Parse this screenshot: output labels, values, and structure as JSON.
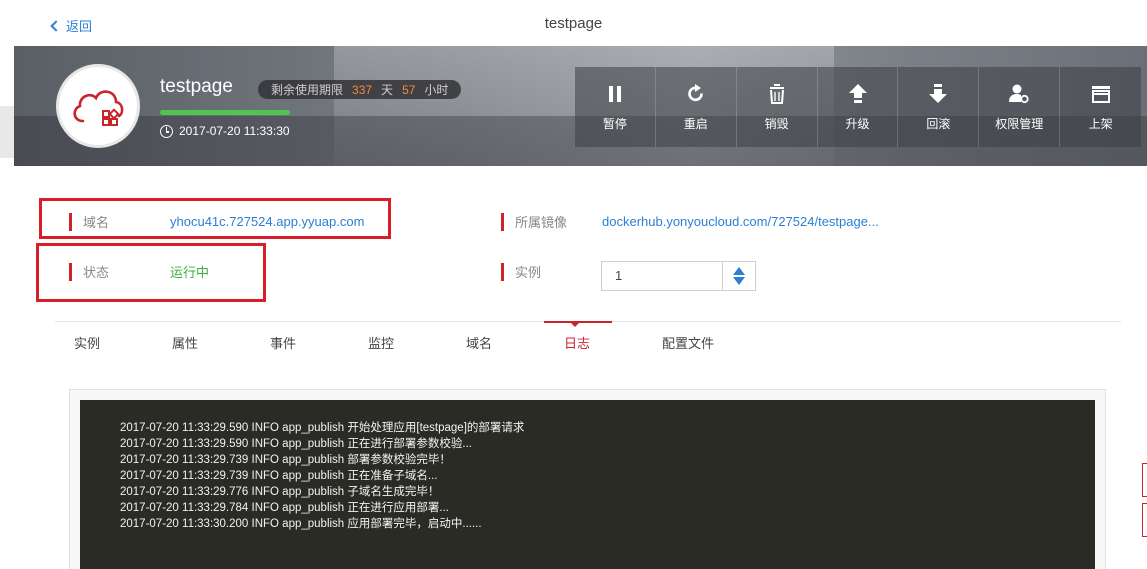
{
  "topbar": {
    "back_label": "返回",
    "title": "testpage"
  },
  "app": {
    "name": "testpage",
    "remaining": {
      "prefix": "剩余使用期限",
      "days": "337",
      "day_unit": "天",
      "hours": "57",
      "hour_unit": "小时"
    },
    "created_at": "2017-07-20 11:33:30",
    "progress_fraction": 1.0,
    "progress_color": "#50c650"
  },
  "actions": [
    {
      "label": "暂停",
      "icon": "pause-icon"
    },
    {
      "label": "重启",
      "icon": "restart-icon"
    },
    {
      "label": "销毁",
      "icon": "trash-icon"
    },
    {
      "label": "升级",
      "icon": "upgrade-icon"
    },
    {
      "label": "回滚",
      "icon": "rollback-icon"
    },
    {
      "label": "权限管理",
      "icon": "user-permission-icon"
    },
    {
      "label": "上架",
      "icon": "shelf-icon"
    }
  ],
  "info": {
    "domain_label": "域名",
    "domain_value": "yhocu41c.727524.app.yyuap.com",
    "status_label": "状态",
    "status_value": "运行中",
    "image_label": "所属镜像",
    "image_value": "dockerhub.yonyoucloud.com/727524/testpage...",
    "instance_label": "实例",
    "instance_value": "1"
  },
  "tabs": [
    {
      "label": "实例",
      "active": false
    },
    {
      "label": "属性",
      "active": false
    },
    {
      "label": "事件",
      "active": false
    },
    {
      "label": "监控",
      "active": false
    },
    {
      "label": "域名",
      "active": false
    },
    {
      "label": "日志",
      "active": true
    },
    {
      "label": "配置文件",
      "active": false
    }
  ],
  "log_lines": [
    "2017-07-20 11:33:29.590 INFO app_publish 开始处理应用[testpage]的部署请求",
    "2017-07-20 11:33:29.590 INFO app_publish 正在进行部署参数校验...",
    "2017-07-20 11:33:29.739 INFO app_publish 部署参数校验完毕！",
    "2017-07-20 11:33:29.739 INFO app_publish 正在准备子域名...",
    "2017-07-20 11:33:29.776 INFO app_publish 子域名生成完毕！",
    "2017-07-20 11:33:29.784 INFO app_publish 正在进行应用部署...",
    "2017-07-20 11:33:30.200 INFO app_publish 应用部署完毕，启动中......"
  ],
  "colors": {
    "accent": "#c9252b",
    "link": "#2a7fd4",
    "running": "#3cae3c",
    "log_bg": "#2b2b26",
    "highlight": "#d81e28"
  }
}
